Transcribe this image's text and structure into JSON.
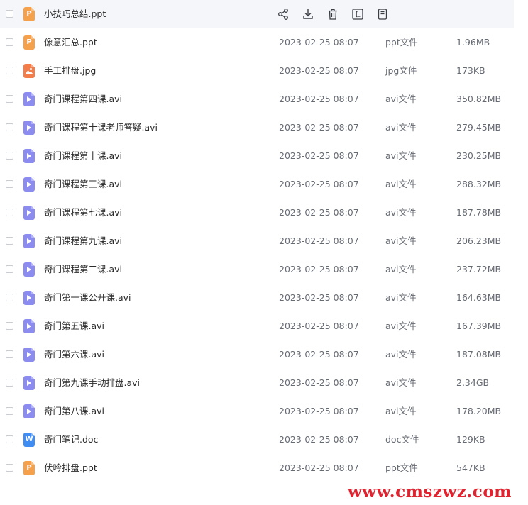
{
  "actions": {
    "share_icon": "share-icon",
    "download_icon": "download-icon",
    "delete_icon": "trash-icon",
    "rename_icon": "rename-icon",
    "more_icon": "file-detail-icon"
  },
  "files": [
    {
      "name": "小技巧总结.ppt",
      "date": "",
      "type": "",
      "size": "",
      "icon": "ppt",
      "icon_label": "P",
      "hover": true
    },
    {
      "name": "像意汇总.ppt",
      "date": "2023-02-25 08:07",
      "type": "ppt文件",
      "size": "1.96MB",
      "icon": "ppt",
      "icon_label": "P"
    },
    {
      "name": "手工排盘.jpg",
      "date": "2023-02-25 08:07",
      "type": "jpg文件",
      "size": "173KB",
      "icon": "img",
      "icon_label": ""
    },
    {
      "name": "奇门课程第四课.avi",
      "date": "2023-02-25 08:07",
      "type": "avi文件",
      "size": "350.82MB",
      "icon": "video",
      "icon_label": ""
    },
    {
      "name": "奇门课程第十课老师答疑.avi",
      "date": "2023-02-25 08:07",
      "type": "avi文件",
      "size": "279.45MB",
      "icon": "video",
      "icon_label": ""
    },
    {
      "name": "奇门课程第十课.avi",
      "date": "2023-02-25 08:07",
      "type": "avi文件",
      "size": "230.25MB",
      "icon": "video",
      "icon_label": ""
    },
    {
      "name": "奇门课程第三课.avi",
      "date": "2023-02-25 08:07",
      "type": "avi文件",
      "size": "288.32MB",
      "icon": "video",
      "icon_label": ""
    },
    {
      "name": "奇门课程第七课.avi",
      "date": "2023-02-25 08:07",
      "type": "avi文件",
      "size": "187.78MB",
      "icon": "video",
      "icon_label": ""
    },
    {
      "name": "奇门课程第九课.avi",
      "date": "2023-02-25 08:07",
      "type": "avi文件",
      "size": "206.23MB",
      "icon": "video",
      "icon_label": ""
    },
    {
      "name": "奇门课程第二课.avi",
      "date": "2023-02-25 08:07",
      "type": "avi文件",
      "size": "237.72MB",
      "icon": "video",
      "icon_label": ""
    },
    {
      "name": "奇门第一课公开课.avi",
      "date": "2023-02-25 08:07",
      "type": "avi文件",
      "size": "164.63MB",
      "icon": "video",
      "icon_label": ""
    },
    {
      "name": "奇门第五课.avi",
      "date": "2023-02-25 08:07",
      "type": "avi文件",
      "size": "167.39MB",
      "icon": "video",
      "icon_label": ""
    },
    {
      "name": "奇门第六课.avi",
      "date": "2023-02-25 08:07",
      "type": "avi文件",
      "size": "187.08MB",
      "icon": "video",
      "icon_label": ""
    },
    {
      "name": "奇门第九课手动排盘.avi",
      "date": "2023-02-25 08:07",
      "type": "avi文件",
      "size": "2.34GB",
      "icon": "video",
      "icon_label": ""
    },
    {
      "name": "奇门第八课.avi",
      "date": "2023-02-25 08:07",
      "type": "avi文件",
      "size": "178.20MB",
      "icon": "video",
      "icon_label": ""
    },
    {
      "name": "奇门笔记.doc",
      "date": "2023-02-25 08:07",
      "type": "doc文件",
      "size": "129KB",
      "icon": "doc",
      "icon_label": "W"
    },
    {
      "name": "伏吟排盘.ppt",
      "date": "2023-02-25 08:07",
      "type": "ppt文件",
      "size": "547KB",
      "icon": "ppt",
      "icon_label": "P"
    }
  ],
  "watermark": "www.cmszwz.com",
  "colors": {
    "ppt": "#f5a04a",
    "img": "#f37e4c",
    "video": "#8b8bf0",
    "doc": "#3f8cf3",
    "watermark": "#e0232f"
  }
}
